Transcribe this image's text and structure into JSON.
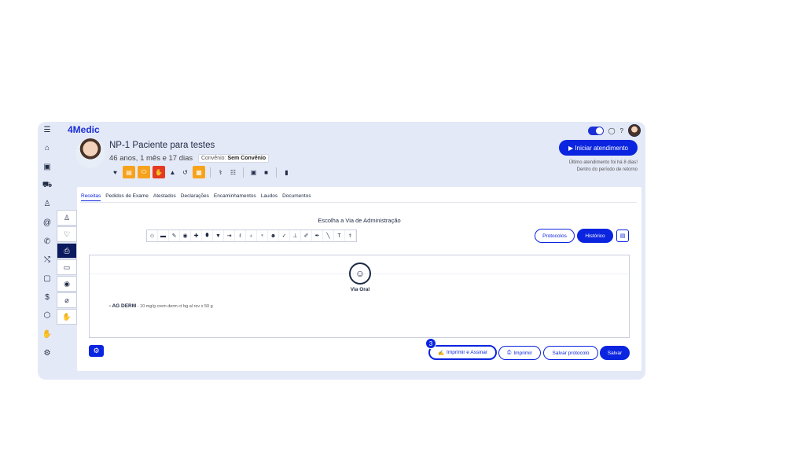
{
  "app": {
    "logo": "4Medic"
  },
  "nav": {
    "icons": [
      "menu-icon",
      "home-icon",
      "calendar-icon",
      "car-icon",
      "user-icon",
      "at-icon",
      "phone-icon",
      "shuffle-icon",
      "clipboard-icon",
      "dollar-icon",
      "cube-icon",
      "hand-icon",
      "settings-icon"
    ]
  },
  "patient": {
    "name": "NP-1 Paciente para testes",
    "age": "46 anos, 1 mês e 17 dias",
    "insurance_label": "Convênio:",
    "insurance_value": "Sem Convênio"
  },
  "header": {
    "start_button": "▶ Iniciar atendimento",
    "last_visit": "Último atendimento foi há 8 dias!",
    "return_period": "Dentro do período de retorno"
  },
  "tabs": [
    {
      "label": "Receitas",
      "active": true
    },
    {
      "label": "Pedidos de Exame"
    },
    {
      "label": "Atestados"
    },
    {
      "label": "Declarações"
    },
    {
      "label": "Encaminhamentos"
    },
    {
      "label": "Laudos"
    },
    {
      "label": "Documentos"
    }
  ],
  "prescription": {
    "choose_title": "Escolha a Via de Administração",
    "protocols_button": "Protocolos",
    "history_button": "Histórico",
    "selected_route": "Via Oral",
    "items": [
      {
        "name": "AG DERM",
        "detail": "- 10 mg/g crem derm ct bg al rev x 50 g"
      }
    ]
  },
  "footer": {
    "step_number": "3",
    "sign_print_button": "Imprimir e Assinar",
    "print_button": "Imprimir",
    "save_protocol_button": "Salvar protocolo",
    "save_button": "Salvar"
  },
  "colors": {
    "primary": "#0a24e0",
    "frame_bg": "#e4e9f7",
    "alert_orange": "#f7a21b",
    "alert_red": "#e53920"
  }
}
